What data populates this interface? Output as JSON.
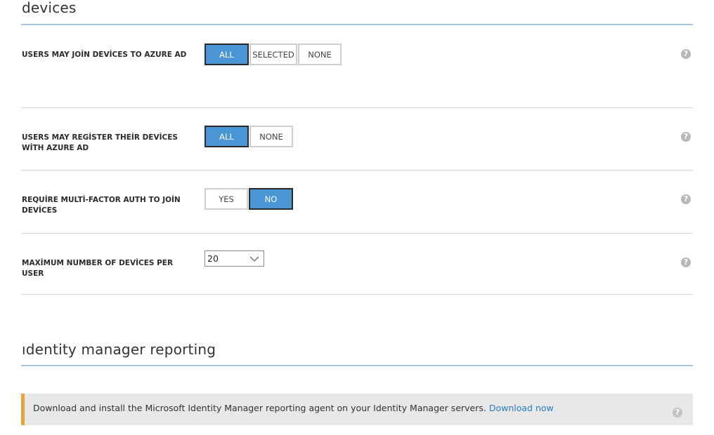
{
  "sections": {
    "devices_title": "devices",
    "reporting_title": "ıdentity manager reporting"
  },
  "settings": {
    "join_devices": {
      "label": "USERS MAY JOİN DEVİCES TO AZURE AD",
      "options": [
        "ALL",
        "SELECTED",
        "NONE"
      ],
      "selected": "ALL"
    },
    "register_devices": {
      "label": "USERS MAY REGİSTER THEİR DEVİCES WİTH AZURE AD",
      "options": [
        "ALL",
        "NONE"
      ],
      "selected": "ALL"
    },
    "mfa_join": {
      "label": "REQUİRE MULTİ-FACTOR AUTH TO JOİN DEVİCES",
      "options": [
        "YES",
        "NO"
      ],
      "selected": "NO"
    },
    "max_devices": {
      "label": "MAXİMUM NUMBER OF DEVİCES PER USER",
      "value": "20"
    }
  },
  "banner": {
    "text": "Download and install the Microsoft Identity Manager reporting agent on your Identity Manager servers.",
    "link_label": "Download now"
  },
  "icons": {
    "help": "?"
  },
  "colors": {
    "selected_bg": "#4a96d4",
    "link": "#2a7ac0",
    "banner_accent": "#e8a33c",
    "section_rule": "#a9c4dc"
  }
}
